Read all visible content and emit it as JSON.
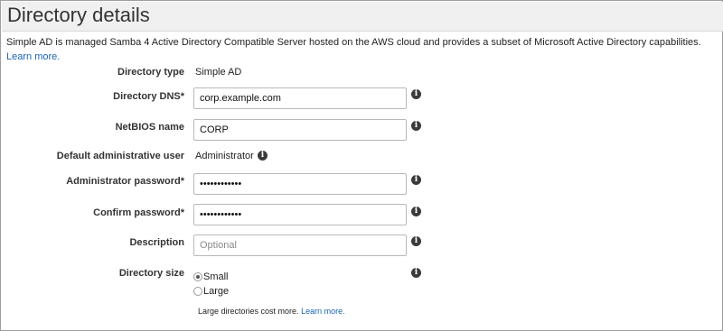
{
  "header": {
    "title": "Directory details"
  },
  "intro": {
    "text": "Simple AD is managed Samba 4 Active Directory Compatible Server hosted on the AWS cloud and provides a subset of Microsoft Active Directory capabilities.",
    "link": "Learn more."
  },
  "form": {
    "directory_type": {
      "label": "Directory type",
      "value": "Simple AD"
    },
    "directory_dns": {
      "label": "Directory DNS*",
      "value": "corp.example.com"
    },
    "netbios": {
      "label": "NetBIOS name",
      "value": "CORP"
    },
    "admin_user": {
      "label": "Default administrative user",
      "value": "Administrator"
    },
    "admin_password": {
      "label": "Administrator password*",
      "value": "••••••••••••"
    },
    "confirm_password": {
      "label": "Confirm password*",
      "value": "••••••••••••"
    },
    "description": {
      "label": "Description",
      "placeholder": "Optional",
      "value": ""
    },
    "directory_size": {
      "label": "Directory size",
      "options": [
        "Small",
        "Large"
      ],
      "selected": "Small",
      "note": "Large directories cost more.",
      "note_link": "Learn more."
    }
  },
  "icons": {
    "info": "info-icon"
  },
  "colors": {
    "link": "#1a64b4",
    "header_bg": "#f0f0f0",
    "frame_border": "#9e9e9e"
  }
}
